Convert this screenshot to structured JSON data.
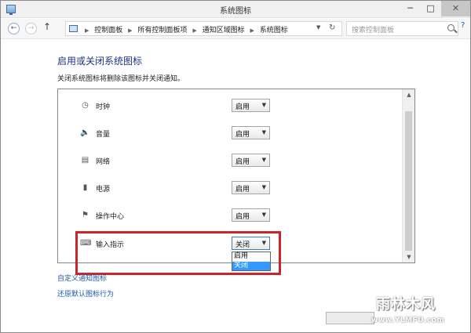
{
  "window": {
    "title": "系统图标",
    "controls": {
      "minimize": "─",
      "maximize": "□",
      "close": "✕"
    }
  },
  "nav": {
    "back_icon": "arrow-left",
    "forward_icon": "arrow-right",
    "up_icon": "arrow-up",
    "breadcrumb": [
      "控制面板",
      "所有控制面板项",
      "通知区域图标",
      "系统图标"
    ],
    "search_placeholder": "搜索控制面板"
  },
  "content": {
    "title": "启用或关闭系统图标",
    "subtitle": "关闭系统图标将删除该图标并关闭通知。",
    "rows": [
      {
        "icon": "clock-icon",
        "label": "时钟",
        "value": "启用"
      },
      {
        "icon": "volume-icon",
        "label": "音量",
        "value": "启用"
      },
      {
        "icon": "network-icon",
        "label": "网络",
        "value": "启用"
      },
      {
        "icon": "power-icon",
        "label": "电源",
        "value": "启用"
      },
      {
        "icon": "action-center-flag-icon",
        "label": "操作中心",
        "value": "启用"
      },
      {
        "icon": "keyboard-icon",
        "label": "输入指示",
        "value": "关闭"
      }
    ],
    "dropdown_options": [
      "启用",
      "关闭"
    ],
    "dropdown_selected_index": 1,
    "links": [
      "自定义通知图标",
      "还原默认图标行为"
    ]
  },
  "watermark": {
    "cn": "雨林木风",
    "url": "www.YLMFU.com"
  },
  "colors": {
    "title": "#1e3287",
    "link": "#1e5aa8",
    "highlight": "#c8262a",
    "selection": "#3399ff"
  }
}
